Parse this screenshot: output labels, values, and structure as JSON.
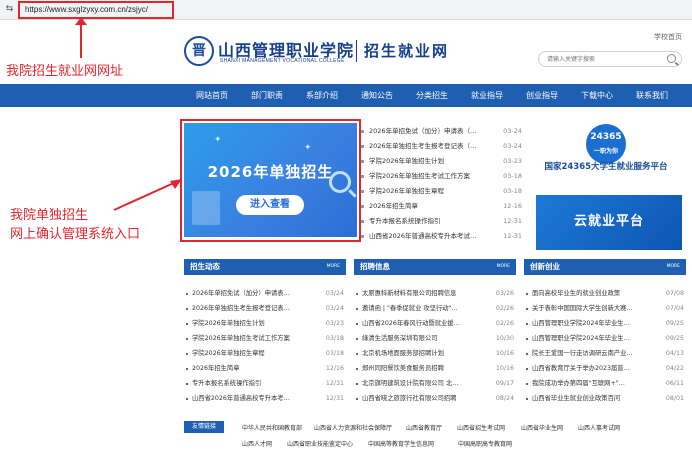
{
  "browser": {
    "url": "https://www.sxglzyxy.com.cn/zsjyc/"
  },
  "header": {
    "logo_text": "山西管理职业学院",
    "logo_en": "SHANXI MANAGEMENT VOCATIONAL COLLEGE",
    "sub_title": "招生就业网",
    "school_home": "学校首页",
    "search_placeholder": "请输入关键字搜索"
  },
  "nav": [
    "网站首页",
    "部门职责",
    "系部介绍",
    "通知公告",
    "分类招生",
    "就业指导",
    "创业指导",
    "下载中心",
    "联系我们"
  ],
  "banner": {
    "title": "2026年单独招生",
    "button": "进入查看"
  },
  "news": [
    {
      "title": "2026年单招免试（加分）申请表（…",
      "date": "03-24"
    },
    {
      "title": "2026年单独招生考生报考登记表（…",
      "date": "03-24"
    },
    {
      "title": "学院2026年单独招生计划",
      "date": "03-23"
    },
    {
      "title": "学院2026年单独招生考试工作方案",
      "date": "03-18"
    },
    {
      "title": "学院2026年单独招生章程",
      "date": "03-18"
    },
    {
      "title": "2026年招生简章",
      "date": "12-16"
    },
    {
      "title": "专升本报名系统操作指引",
      "date": "12-31"
    },
    {
      "title": "山西省2026年普通高校专升本考试…",
      "date": "12-31"
    }
  ],
  "promos": {
    "badge_top": "24365",
    "badge_bottom": "一职为你",
    "platform_title": "国家24365大学生就业服务平台",
    "cloud": "云就业平台"
  },
  "columns": [
    {
      "title": "招生动态",
      "more": "MORE",
      "items": [
        {
          "title": "2026年单招免试（加分）申请表…",
          "date": "03/24"
        },
        {
          "title": "2026年单独招生考生报考登记表…",
          "date": "03/24"
        },
        {
          "title": "学院2026年单独招生计划",
          "date": "03/23"
        },
        {
          "title": "学院2026年单独招生考试工作方案",
          "date": "03/18"
        },
        {
          "title": "学院2026年单独招生章程",
          "date": "03/18"
        },
        {
          "title": "2026年招生简章",
          "date": "12/16"
        },
        {
          "title": "专升本报名系统操作指引",
          "date": "12/31"
        },
        {
          "title": "山西省2026年普通高校专升本考…",
          "date": "12/31"
        }
      ]
    },
    {
      "title": "招聘信息",
      "more": "MORE",
      "items": [
        {
          "title": "太原惠科新材料有限公司招聘信息",
          "date": "03/26"
        },
        {
          "title": "邀请函 | \"春季促就业 攻坚行动\"…",
          "date": "02/26"
        },
        {
          "title": "山西省2026年春风行动暨就业援…",
          "date": "02/26"
        },
        {
          "title": "綠清生活服务深圳有限公司",
          "date": "10/30"
        },
        {
          "title": "北京机场地面服务部招聘计划",
          "date": "10/16"
        },
        {
          "title": "郑州同阳餐饮美食服务员招聘",
          "date": "10/16"
        },
        {
          "title": "北京旗明建筑设计院有限公司 北…",
          "date": "09/17"
        },
        {
          "title": "山西省晓之旅旅行社有限公司招聘",
          "date": "08/24"
        }
      ]
    },
    {
      "title": "创新创业",
      "more": "MORE",
      "items": [
        {
          "title": "面向高校毕业生的就业创业政策",
          "date": "07/08"
        },
        {
          "title": "关于表彰中国国际大学生创新大赛…",
          "date": "07/04"
        },
        {
          "title": "山西管理职业学院2024年毕业生…",
          "date": "09/25"
        },
        {
          "title": "山西管理职业学院2024年毕业生…",
          "date": "09/25"
        },
        {
          "title": "院长王爱国一行走访调研云南产业…",
          "date": "04/13"
        },
        {
          "title": "山西省教育厅关于举办2023届普…",
          "date": "04/22"
        },
        {
          "title": "我院成功举办第四届\"互联网+\"…",
          "date": "06/11"
        },
        {
          "title": "山西省毕业生就业创业政策百问",
          "date": "08/01"
        }
      ]
    }
  ],
  "friend_links": {
    "label": "友情链接",
    "row1": [
      "中华人民共和国教育部",
      "山西省人力资源和社会保障厅",
      "山西省教育厅",
      "山西省招生考试网",
      "山西省毕业生网",
      "山西人事考试网"
    ],
    "row2": [
      "山西人才网",
      "山西省职业技能鉴定中心",
      "中国高等教育学生信息网",
      "中国高职高专教育网"
    ]
  },
  "annotations": {
    "url_note": "我院招生就业网网址",
    "entry_note_1": "我院单独招生",
    "entry_note_2": "网上确认管理系统入口"
  }
}
